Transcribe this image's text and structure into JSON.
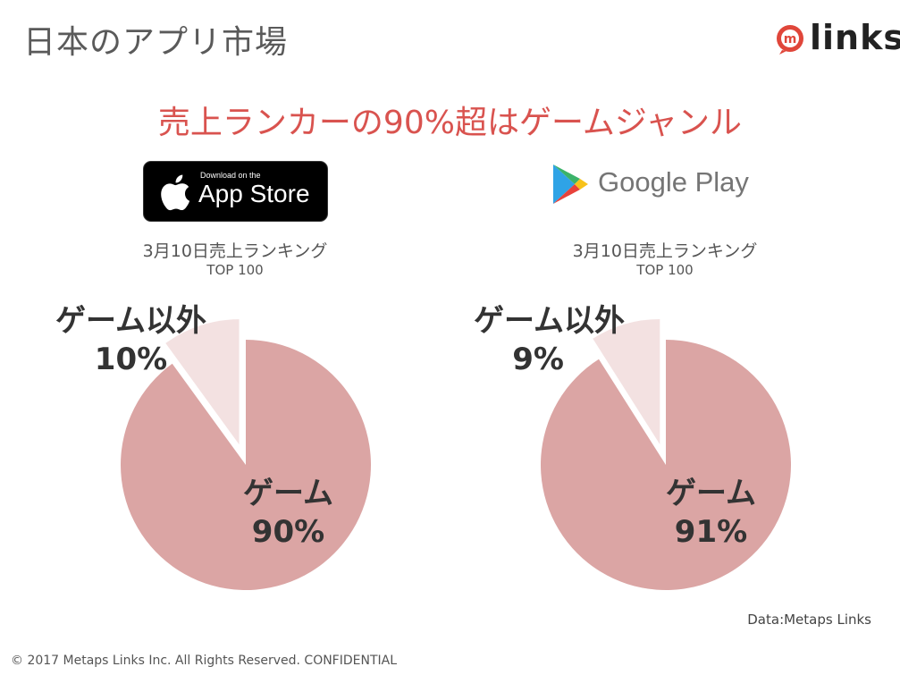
{
  "header": {
    "title": "日本のアプリ市場",
    "logo_text": "links"
  },
  "headline": "売上ランカーの90%超はゲームジャンル",
  "stores": {
    "appstore": {
      "badge_small": "Download on the",
      "badge_big": "App Store"
    },
    "googleplay": {
      "name": "Google Play"
    }
  },
  "chart_data": [
    {
      "type": "pie",
      "title": "3月10日売上ランキング",
      "subtitle": "TOP 100",
      "categories": [
        "ゲーム",
        "ゲーム以外"
      ],
      "values": [
        90,
        10
      ],
      "labels": [
        "90%",
        "10%"
      ],
      "colors": [
        "#dba5a4",
        "#f3e1e1"
      ],
      "exploded": "ゲーム以外"
    },
    {
      "type": "pie",
      "title": "3月10日売上ランキング",
      "subtitle": "TOP 100",
      "categories": [
        "ゲーム",
        "ゲーム以外"
      ],
      "values": [
        91,
        9
      ],
      "labels": [
        "91%",
        "9%"
      ],
      "colors": [
        "#dba5a4",
        "#f3e1e1"
      ],
      "exploded": "ゲーム以外"
    }
  ],
  "source": "Data:Metaps Links",
  "footer": "© 2017 Metaps Links Inc. All Rights Reserved. CONFIDENTIAL",
  "colors": {
    "headline": "#d9534f",
    "game_slice": "#dba5a4",
    "other_slice": "#f3e1e1"
  }
}
